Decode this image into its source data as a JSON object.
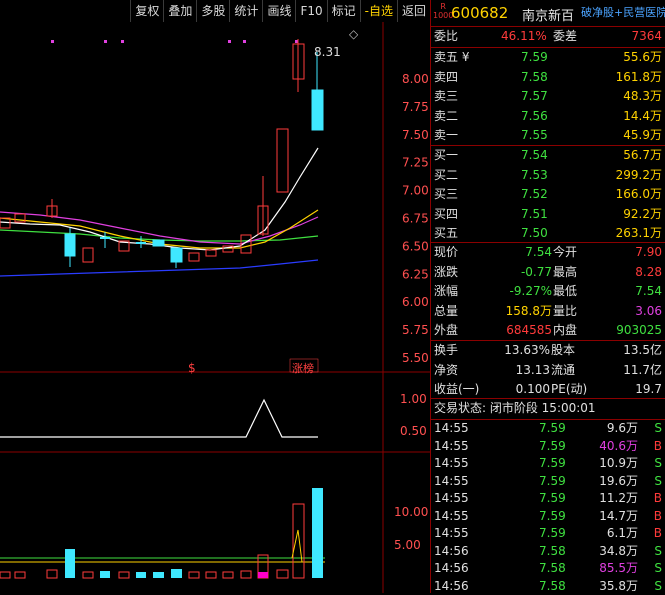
{
  "toolbar": [
    "复权",
    "叠加",
    "多股",
    "统计",
    "画线",
    "F10",
    "标记",
    "-自选",
    "返回"
  ],
  "stock": {
    "tag1": "R",
    "tag2": "1000",
    "code": "600682",
    "name": "南京新百",
    "subtitle": "破净股+民营医院"
  },
  "weibi": {
    "label1": "委比",
    "val1": "46.11%",
    "label2": "委差",
    "val2": "7364"
  },
  "asks": [
    {
      "label": "卖五 ¥",
      "price": "7.59",
      "vol": "55.6万"
    },
    {
      "label": "卖四",
      "price": "7.58",
      "vol": "161.8万"
    },
    {
      "label": "卖三",
      "price": "7.57",
      "vol": "48.3万"
    },
    {
      "label": "卖二",
      "price": "7.56",
      "vol": "14.4万"
    },
    {
      "label": "卖一",
      "price": "7.55",
      "vol": "45.9万"
    }
  ],
  "bids": [
    {
      "label": "买一",
      "price": "7.54",
      "vol": "56.7万"
    },
    {
      "label": "买二",
      "price": "7.53",
      "vol": "299.2万"
    },
    {
      "label": "买三",
      "price": "7.52",
      "vol": "166.0万"
    },
    {
      "label": "买四",
      "price": "7.51",
      "vol": "92.2万"
    },
    {
      "label": "买五",
      "price": "7.50",
      "vol": "263.1万"
    }
  ],
  "quote": [
    {
      "l1": "现价",
      "v1": "7.54",
      "c1": "g",
      "l2": "今开",
      "v2": "7.90",
      "c2": "r"
    },
    {
      "l1": "涨跌",
      "v1": "-0.77",
      "c1": "g",
      "l2": "最高",
      "v2": "8.28",
      "c2": "r"
    },
    {
      "l1": "涨幅",
      "v1": "-9.27%",
      "c1": "g",
      "l2": "最低",
      "v2": "7.54",
      "c2": "g"
    },
    {
      "l1": "总量",
      "v1": "158.8万",
      "c1": "y",
      "l2": "量比",
      "v2": "3.06",
      "c2": "m"
    },
    {
      "l1": "外盘",
      "v1": "684585",
      "c1": "r",
      "l2": "内盘",
      "v2": "903025",
      "c2": "g"
    }
  ],
  "fund": [
    {
      "l1": "换手",
      "v1": "13.63%",
      "l2": "股本",
      "v2": "13.5亿"
    },
    {
      "l1": "净资",
      "v1": "13.13",
      "l2": "流通",
      "v2": "11.7亿"
    },
    {
      "l1": "收益(一)",
      "v1": "0.100",
      "l2": "PE(动)",
      "v2": "19.7"
    }
  ],
  "trade_status": "交易状态: 闭市阶段 15:00:01",
  "ticks": [
    {
      "t": "14:55",
      "p": "7.59",
      "v": "9.6万",
      "vc": "w",
      "s": "S"
    },
    {
      "t": "14:55",
      "p": "7.59",
      "v": "40.6万",
      "vc": "m",
      "s": "B"
    },
    {
      "t": "14:55",
      "p": "7.59",
      "v": "10.9万",
      "vc": "w",
      "s": "S"
    },
    {
      "t": "14:55",
      "p": "7.59",
      "v": "19.6万",
      "vc": "w",
      "s": "S"
    },
    {
      "t": "14:55",
      "p": "7.59",
      "v": "11.2万",
      "vc": "w",
      "s": "B"
    },
    {
      "t": "14:55",
      "p": "7.59",
      "v": "14.7万",
      "vc": "w",
      "s": "B"
    },
    {
      "t": "14:55",
      "p": "7.59",
      "v": "6.1万",
      "vc": "w",
      "s": "B"
    },
    {
      "t": "14:56",
      "p": "7.58",
      "v": "34.8万",
      "vc": "w",
      "s": "S"
    },
    {
      "t": "14:56",
      "p": "7.58",
      "v": "85.5万",
      "vc": "m",
      "s": "S"
    },
    {
      "t": "14:56",
      "p": "7.58",
      "v": "35.8万",
      "vc": "w",
      "s": "S"
    }
  ],
  "chart_data": {
    "type": "candlestick",
    "price_axis": [
      "8.00",
      "7.75",
      "7.50",
      "7.25",
      "7.00",
      "6.75",
      "6.50",
      "6.25",
      "6.00",
      "5.75",
      "5.50"
    ],
    "high_label": "8.31",
    "markers": [
      "$",
      "涨榜"
    ],
    "ind_axis": [
      "1.00",
      "0.50"
    ],
    "vol_axis": [
      "10.00",
      "5.00"
    ],
    "colors": {
      "up": "#ff3b3b",
      "down": "#3fe8ff",
      "ma1": "#ffffff",
      "ma2": "#ffd200",
      "ma3": "#e040e0",
      "ma4": "#3fe040",
      "ma5": "#2a3cff"
    }
  }
}
